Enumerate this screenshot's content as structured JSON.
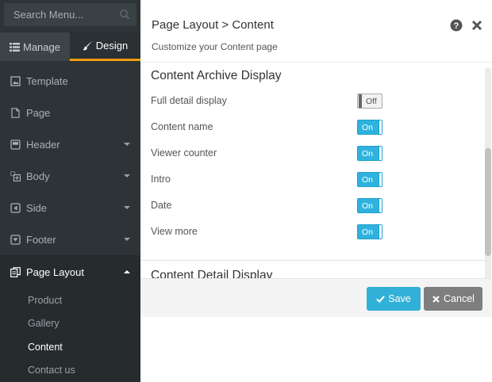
{
  "sidebar": {
    "search": {
      "placeholder": "Search Menu..."
    },
    "tabs": [
      {
        "label": "Manage",
        "icon": "list-icon"
      },
      {
        "label": "Design",
        "icon": "brush-icon"
      }
    ],
    "items": [
      {
        "label": "Template",
        "icon": "template-icon"
      },
      {
        "label": "Page",
        "icon": "page-icon"
      },
      {
        "label": "Header",
        "icon": "header-icon"
      },
      {
        "label": "Body",
        "icon": "body-icon"
      },
      {
        "label": "Side",
        "icon": "side-icon"
      },
      {
        "label": "Footer",
        "icon": "footer-icon"
      },
      {
        "label": "Page Layout",
        "icon": "page-layout-icon"
      }
    ],
    "subitems": [
      {
        "label": "Product"
      },
      {
        "label": "Gallery"
      },
      {
        "label": "Content"
      },
      {
        "label": "Contact us"
      }
    ]
  },
  "main": {
    "title": "Page Layout > Content",
    "subtitle": "Customize your Content page",
    "section1": {
      "title": "Content Archive Display",
      "rows": [
        {
          "label": "Full detail display",
          "state": "Off"
        },
        {
          "label": "Content name",
          "state": "On"
        },
        {
          "label": "Viewer counter",
          "state": "On"
        },
        {
          "label": "Intro",
          "state": "On"
        },
        {
          "label": "Date",
          "state": "On"
        },
        {
          "label": "View more",
          "state": "On"
        }
      ]
    },
    "section2": {
      "title": "Content Detail Display"
    },
    "buttons": {
      "save": "Save",
      "cancel": "Cancel"
    }
  },
  "colors": {
    "sidebar_bg": "#2d3336",
    "accent_tab": "#f39c12",
    "toggle_on": "#2fb3de",
    "save_button": "#31b0d8",
    "cancel_button": "#7e7e7e"
  }
}
